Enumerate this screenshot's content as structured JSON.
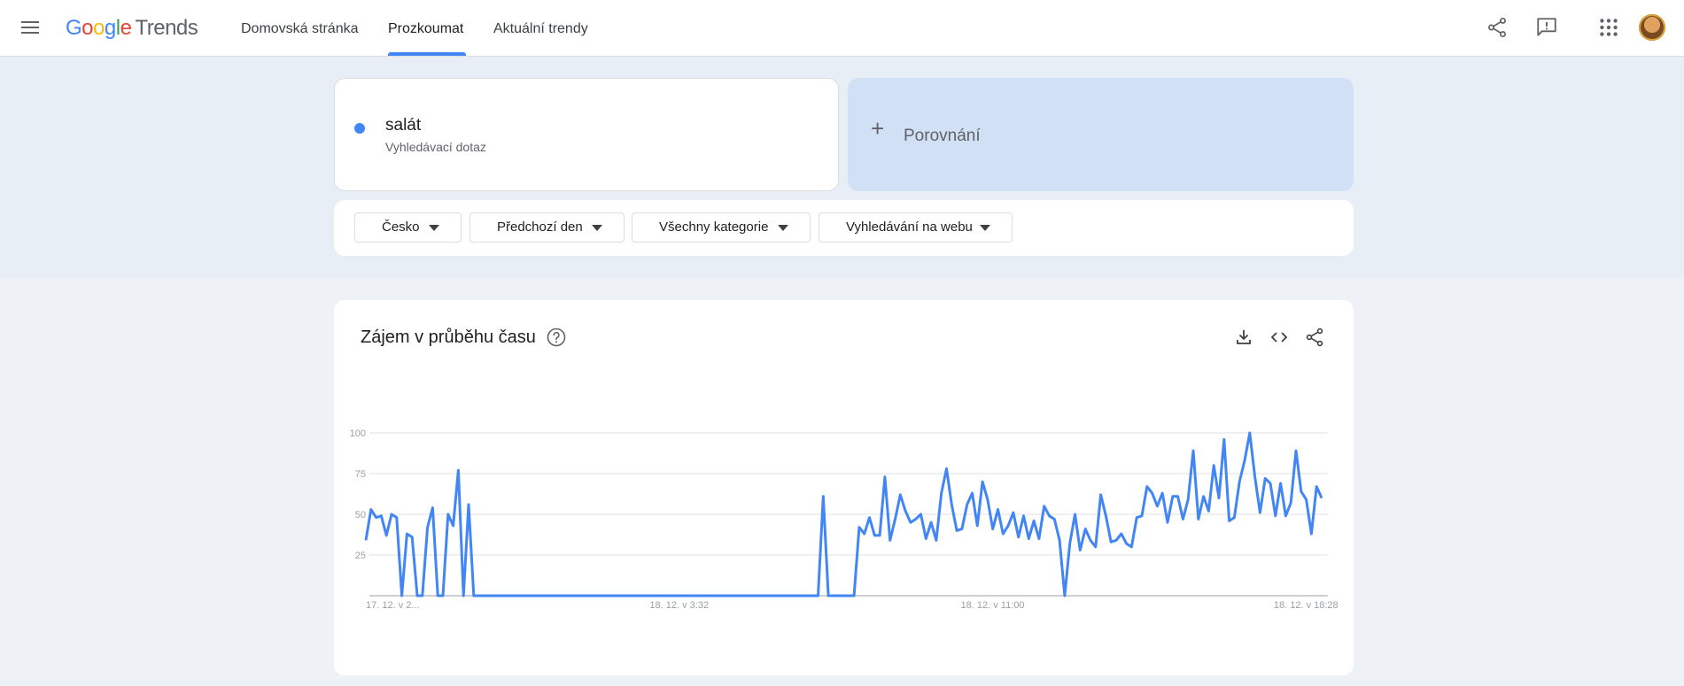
{
  "header": {
    "logo_google": "Google",
    "logo_trends": "Trends",
    "tabs": [
      {
        "label": "Domovská stránka"
      },
      {
        "label": "Prozkoumat"
      },
      {
        "label": "Aktuální trendy"
      }
    ],
    "active_tab": "Prozkoumat",
    "icons": [
      "menu-icon",
      "share-icon",
      "feedback-icon",
      "apps-icon",
      "avatar"
    ]
  },
  "search": {
    "term": "salát",
    "term_type": "Vyhledávací dotaz",
    "term_color": "#4285f4",
    "compare_label": "Porovnání"
  },
  "filters": [
    {
      "label": "Česko"
    },
    {
      "label": "Předchozí den"
    },
    {
      "label": "Všechny kategorie"
    },
    {
      "label": "Vyhledávání na webu"
    }
  ],
  "chart_card": {
    "title": "Zájem v průběhu času",
    "icons": [
      "help-icon",
      "download-icon",
      "embed-icon",
      "share-icon"
    ]
  },
  "chart_data": {
    "type": "line",
    "series": [
      {
        "color": "#4285f4",
        "values": [
          34,
          53,
          48,
          49,
          37,
          50,
          48,
          0,
          38,
          36,
          0,
          0,
          42,
          54,
          0,
          0,
          50,
          43,
          77,
          0,
          56,
          0,
          0,
          0,
          0,
          0,
          0,
          0,
          0,
          0,
          0,
          0,
          0,
          0,
          0,
          0,
          0,
          0,
          0,
          0,
          0,
          0,
          0,
          0,
          0,
          0,
          0,
          0,
          0,
          0,
          0,
          0,
          0,
          0,
          0,
          0,
          0,
          0,
          0,
          0,
          0,
          0,
          0,
          0,
          0,
          0,
          0,
          0,
          0,
          0,
          0,
          0,
          0,
          0,
          0,
          0,
          0,
          0,
          0,
          0,
          0,
          0,
          0,
          0,
          0,
          0,
          0,
          0,
          0,
          61,
          0,
          0,
          0,
          0,
          0,
          0,
          42,
          38,
          48,
          37,
          37,
          73,
          34,
          47,
          62,
          52,
          45,
          47,
          50,
          35,
          45,
          34,
          63,
          78,
          56,
          40,
          41,
          56,
          63,
          43,
          70,
          59,
          41,
          53,
          38,
          43,
          51,
          36,
          49,
          35,
          46,
          35,
          55,
          49,
          47,
          34,
          0,
          32,
          50,
          28,
          41,
          34,
          30,
          62,
          49,
          33,
          34,
          38,
          32,
          30,
          48,
          49,
          67,
          63,
          55,
          63,
          45,
          61,
          61,
          47,
          59,
          89,
          47,
          61,
          52,
          80,
          60,
          96,
          46,
          48,
          70,
          83,
          100,
          73,
          51,
          72,
          69,
          49,
          69,
          49,
          57,
          89,
          64,
          59,
          38,
          67,
          60
        ]
      }
    ],
    "x_tick_labels": [
      "17. 12. v 2...",
      "18. 12. v 3:32",
      "18. 12. v 11:00",
      "18. 12. v 18:28"
    ],
    "y_tick_labels": [
      "100",
      "75",
      "50",
      "25"
    ],
    "ylim": [
      0,
      100
    ],
    "grid": true
  }
}
